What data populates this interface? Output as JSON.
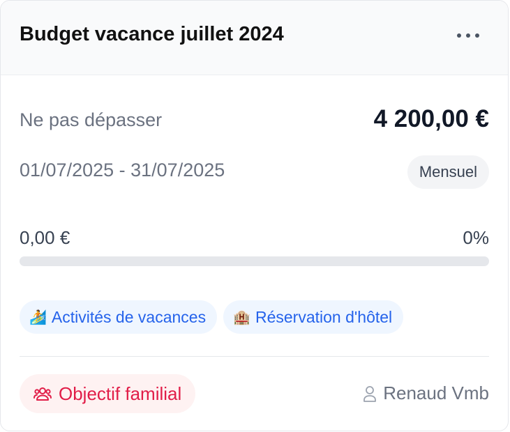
{
  "budget": {
    "title": "Budget vacance juillet 2024",
    "limit_label": "Ne pas dépasser",
    "limit_value": "4 200,00 €",
    "period": "01/07/2025 - 31/07/2025",
    "frequency": "Mensuel",
    "spent": "0,00 €",
    "percent": "0%",
    "progress_fraction": 0
  },
  "categories": [
    {
      "emoji": "🏄",
      "label": "Activités de vacances"
    },
    {
      "emoji": "🏨",
      "label": "Réservation d'hôtel"
    }
  ],
  "footer": {
    "goal_label": "Objectif familial",
    "goal_icon": "group-icon",
    "owner": "Renaud Vmb",
    "owner_icon": "user-icon"
  },
  "colors": {
    "accent_blue": "#2563eb",
    "goal_red": "#e11d48",
    "progress_track": "#e5e7eb"
  }
}
